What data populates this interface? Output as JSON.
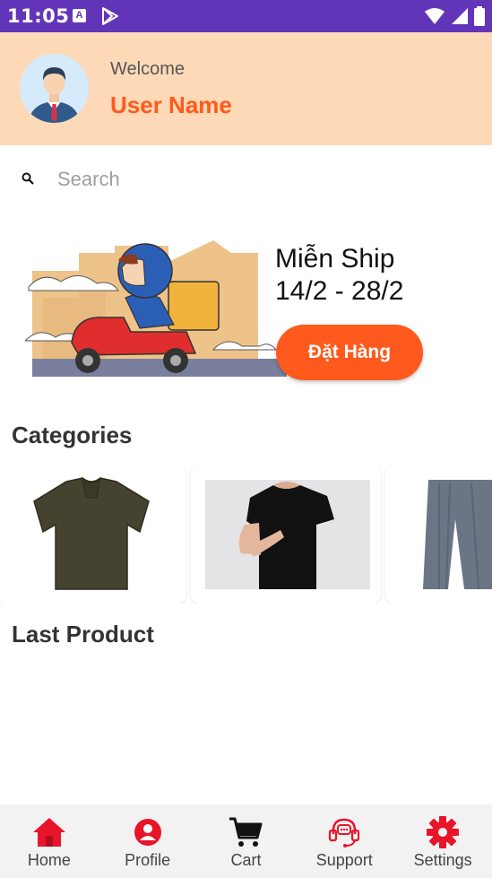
{
  "status_bar": {
    "time": "11:05",
    "notification_letter": "A"
  },
  "header": {
    "welcome": "Welcome",
    "user_name": "User Name"
  },
  "search": {
    "placeholder": "Search",
    "value": ""
  },
  "banner": {
    "title": "Miễn Ship",
    "date_range": "14/2 - 28/2",
    "button_label": "Đặt Hàng"
  },
  "sections": {
    "categories": "Categories",
    "last_product": "Last Product"
  },
  "categories": [
    {
      "icon": "olive-polo-shirt"
    },
    {
      "icon": "black-tshirt-model"
    },
    {
      "icon": "grey-trousers"
    }
  ],
  "bottom_nav": [
    {
      "label": "Home",
      "icon": "home-icon"
    },
    {
      "label": "Profile",
      "icon": "profile-icon"
    },
    {
      "label": "Cart",
      "icon": "cart-icon"
    },
    {
      "label": "Support",
      "icon": "support-icon"
    },
    {
      "label": "Settings",
      "icon": "settings-icon"
    }
  ],
  "colors": {
    "status_bar": "#6235b8",
    "header_bg": "#fed9b7",
    "accent": "#fe5a1d",
    "nav_red": "#e8142a"
  }
}
